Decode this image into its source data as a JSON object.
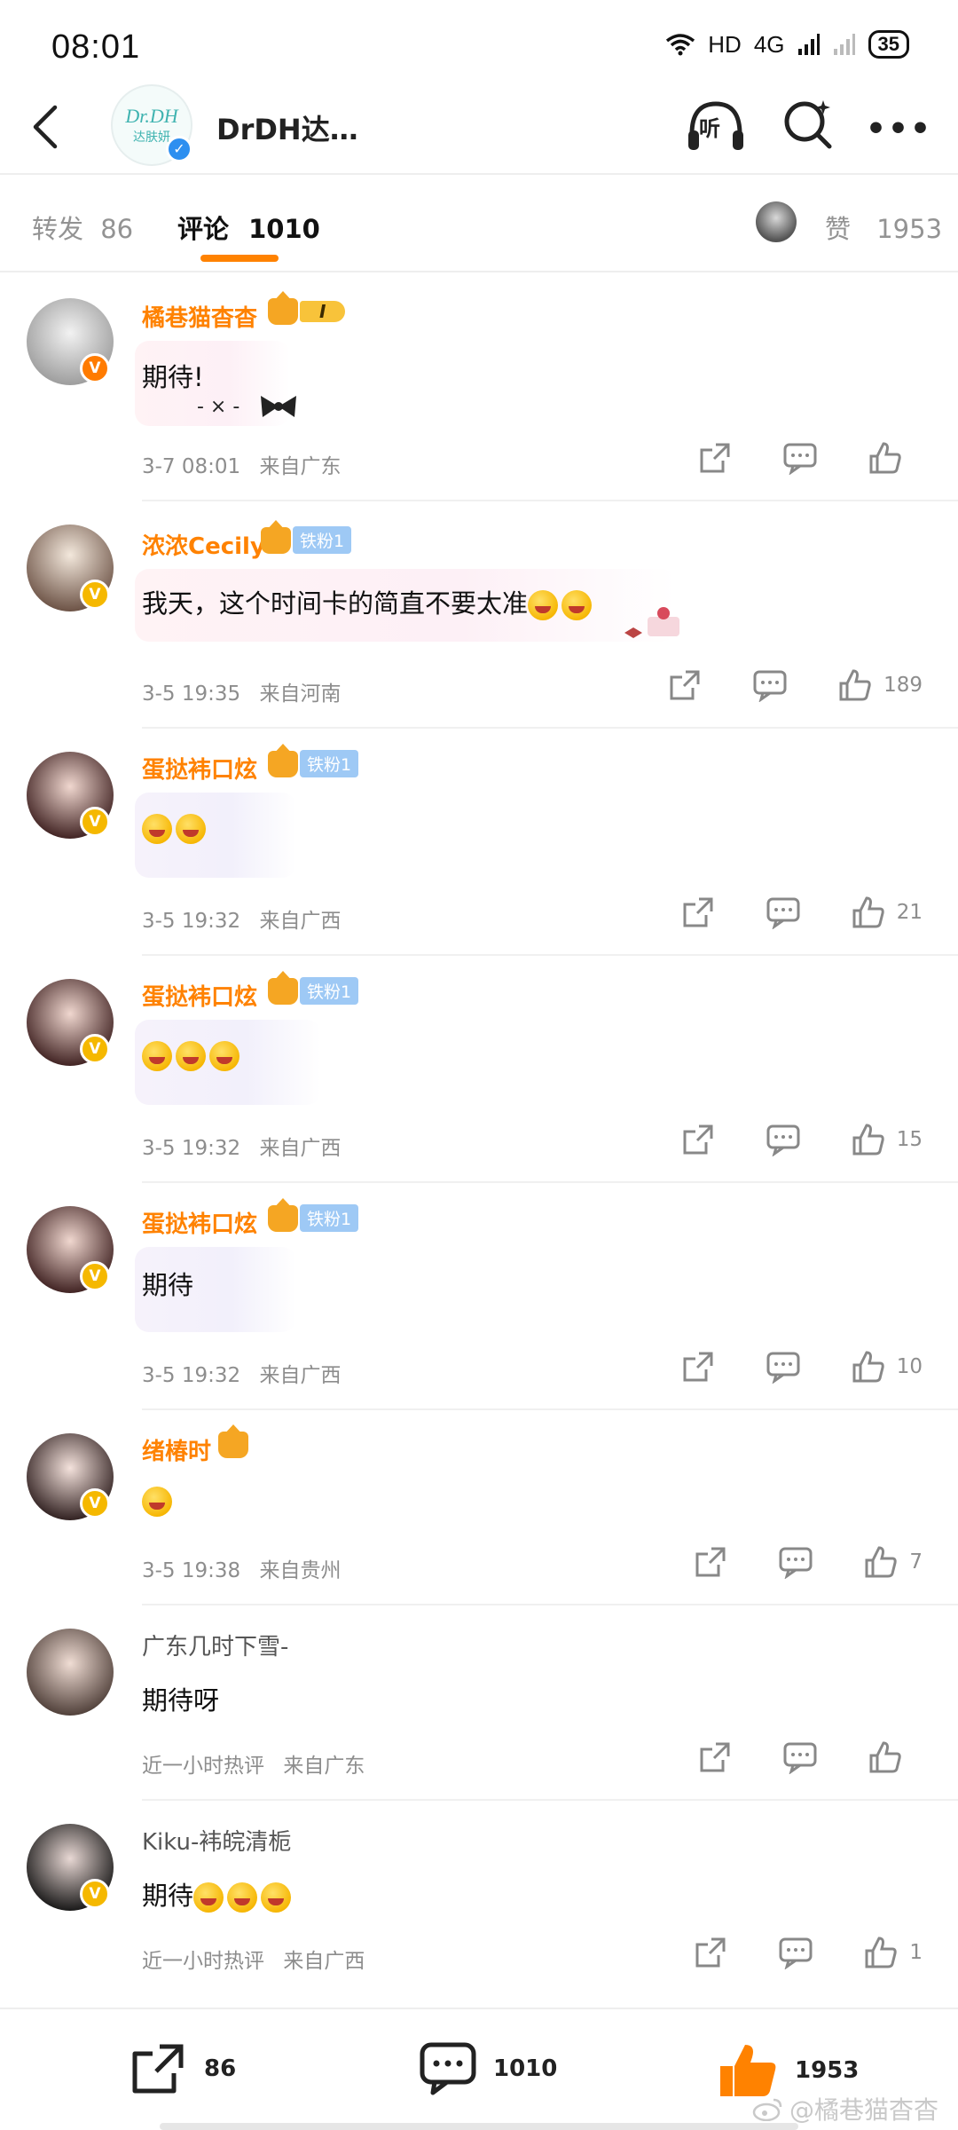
{
  "status_bar": {
    "time": "08:01",
    "network": "HD",
    "signal": "4G",
    "battery": "35"
  },
  "header": {
    "title": "DrDH达…",
    "logo_text_1": "Dr.DH",
    "logo_text_2": "达肤妍",
    "listen_label": "听"
  },
  "tabs": {
    "repost_label": "转发",
    "repost_count": "86",
    "comments_label": "评论",
    "comments_count": "1010",
    "likes_label": "赞",
    "likes_count": "1953"
  },
  "comments": [
    {
      "name": "橘巷猫杳杳",
      "badge_level": "I",
      "text": "期待!",
      "time": "3-7 08:01",
      "location": "来自广东",
      "likes": ""
    },
    {
      "name": "浓浓Cecily",
      "badge_fan": "铁粉1",
      "text": "我天，这个时间卡的简直不要太准",
      "time": "3-5 19:35",
      "location": "来自河南",
      "likes": "189"
    },
    {
      "name": "蛋挞袆口炫",
      "badge_fan": "铁粉1",
      "text": "",
      "time": "3-5 19:32",
      "location": "来自广西",
      "likes": "21"
    },
    {
      "name": "蛋挞袆口炫",
      "badge_fan": "铁粉1",
      "text": "",
      "time": "3-5 19:32",
      "location": "来自广西",
      "likes": "15"
    },
    {
      "name": "蛋挞袆口炫",
      "badge_fan": "铁粉1",
      "text": "期待",
      "time": "3-5 19:32",
      "location": "来自广西",
      "likes": "10"
    },
    {
      "name": "绪椿时",
      "text": "",
      "time": "3-5 19:38",
      "location": "来自贵州",
      "likes": "7"
    },
    {
      "name": "广东几时下雪-",
      "text": "期待呀",
      "time": "近一小时热评",
      "location": "来自广东",
      "likes": ""
    },
    {
      "name": "Kiku-袆皖清栀",
      "text": "期待",
      "time": "近一小时热评",
      "location": "来自广西",
      "likes": "1"
    }
  ],
  "bottom_bar": {
    "repost_count": "86",
    "comment_count": "1010",
    "like_count": "1953"
  },
  "watermark": "@橘巷猫杳杳",
  "colors": {
    "accent": "#ff8200",
    "name_orange": "#ff8200",
    "meta_gray": "#8d8d8d",
    "verified_yellow": "#f5b800",
    "verified_orange": "#ff7b00",
    "verified_blue": "#2d8ff0"
  },
  "icons": {
    "back": "chevron-left-icon",
    "listen": "headphones-icon",
    "search": "search-icon",
    "more": "more-icon",
    "share": "share-icon",
    "comment": "comment-icon",
    "like": "thumb-up-icon"
  }
}
